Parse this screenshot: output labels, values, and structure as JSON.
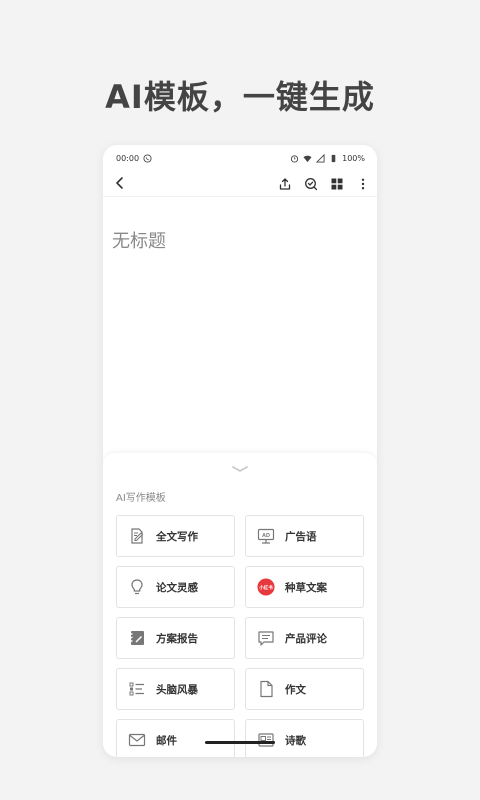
{
  "headline": "AI模板，一键生成",
  "status_bar": {
    "time": "00:00",
    "battery": "100%"
  },
  "editor": {
    "title_placeholder": "无标题"
  },
  "panel": {
    "section_label": "AI写作模板",
    "templates": [
      {
        "label": "全文写作",
        "icon": "pencil-doc-icon"
      },
      {
        "label": "广告语",
        "icon": "ad-board-icon"
      },
      {
        "label": "论文灵感",
        "icon": "lightbulb-icon"
      },
      {
        "label": "种草文案",
        "icon": "xiaohongshu-icon",
        "badge_text": "小红书"
      },
      {
        "label": "方案报告",
        "icon": "notebook-icon"
      },
      {
        "label": "产品评论",
        "icon": "comment-icon"
      },
      {
        "label": "头脑风暴",
        "icon": "list-icon"
      },
      {
        "label": "作文",
        "icon": "document-icon"
      },
      {
        "label": "邮件",
        "icon": "mail-icon"
      },
      {
        "label": "诗歌",
        "icon": "newspaper-icon"
      }
    ]
  },
  "colors": {
    "background": "#f4f3f3",
    "badge_red": "#e8383d",
    "icon_gray": "#777777"
  }
}
